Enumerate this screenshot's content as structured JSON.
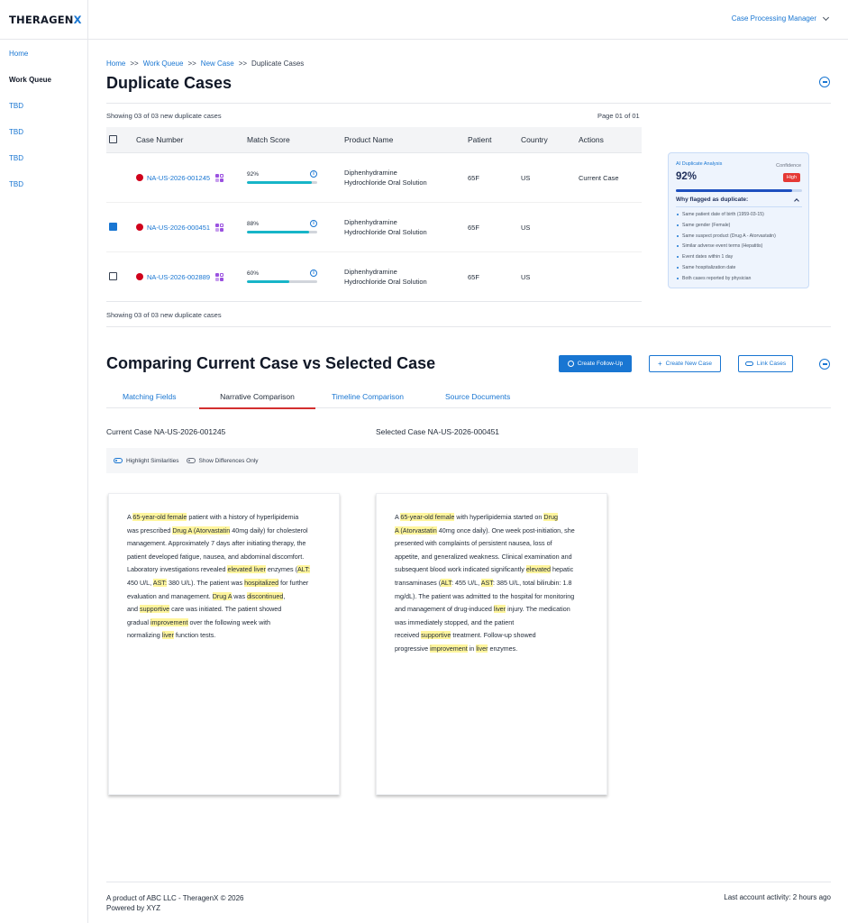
{
  "brand": {
    "name": "THERAGEN",
    "accent": "X"
  },
  "user_menu": {
    "label": "Case Processing Manager"
  },
  "sidebar": {
    "items": [
      {
        "label": "Home",
        "active": false
      },
      {
        "label": "Work Queue",
        "active": true
      },
      {
        "label": "TBD",
        "active": false
      },
      {
        "label": "TBD",
        "active": false
      },
      {
        "label": "TBD",
        "active": false
      },
      {
        "label": "TBD",
        "active": false
      }
    ]
  },
  "breadcrumb": {
    "items": [
      "Home",
      "Work Queue",
      "New Case"
    ],
    "separator": ">>",
    "current": "Duplicate Cases"
  },
  "page_title": "Duplicate Cases",
  "duplicates": {
    "showing_top": "Showing 03 of 03 new duplicate cases",
    "page_label": "Page 01 of 01",
    "showing_bottom": "Showing 03 of 03 new duplicate cases",
    "columns": [
      "Case Number",
      "Match Score",
      "Product Name",
      "Patient",
      "Country",
      "Actions"
    ],
    "rows": [
      {
        "checkbox": "none",
        "case_number": "NA-US-2026-001245",
        "score_label": "92%",
        "score": 0.92,
        "product_line1": "Diphenhydramine",
        "product_line2": "Hydrochloride Oral Solution",
        "patient": "65F",
        "country": "US",
        "action": "Current Case"
      },
      {
        "checkbox": "checked",
        "case_number": "NA-US-2026-000451",
        "score_label": "88%",
        "score": 0.88,
        "product_line1": "Diphenhydramine",
        "product_line2": "Hydrochloride Oral Solution",
        "patient": "65F",
        "country": "US",
        "action": ""
      },
      {
        "checkbox": "unchecked",
        "case_number": "NA-US-2026-002889",
        "score_label": "60%",
        "score": 0.6,
        "product_line1": "Diphenhydramine",
        "product_line2": "Hydrochloride Oral Solution",
        "patient": "65F",
        "country": "US",
        "action": ""
      }
    ]
  },
  "ai_analysis": {
    "title": "AI Duplicate Analysis",
    "confidence_label": "Confidence",
    "score_label": "92%",
    "score": 0.92,
    "badge": "High",
    "why_label": "Why flagged as duplicate:",
    "reasons": [
      "Same patient date of birth (1959-03-15)",
      "Same gender (Female)",
      "Same suspect product (Drug A - Atorvastatin)",
      "Similar adverse event terms (Hepatitis)",
      "Event dates within 1 day",
      "Same hospitalization date",
      "Both cases reported by physician"
    ]
  },
  "comparison": {
    "title": "Comparing Current Case vs Selected Case",
    "buttons": {
      "follow_up": "Create Follow-Up",
      "new_case": "Create New Case",
      "link": "Link Cases"
    },
    "tabs": [
      "Matching Fields",
      "Narrative Comparison",
      "Timeline Comparison",
      "Source Documents"
    ],
    "active_tab": 1,
    "current_case_label": "Current Case NA-US-2026-001245",
    "selected_case_label": "Selected Case NA-US-2026-000451",
    "toggles": {
      "highlight": "Highlight Similarities",
      "differences": "Show Differences Only"
    },
    "left_narrative": [
      [
        "A ",
        {
          "h": "65-year-old female"
        },
        " patient with a history of hyperlipidemia"
      ],
      [
        "was prescribed ",
        {
          "h": "Drug A (Atorvastatin"
        },
        " 40mg daily) for cholesterol"
      ],
      [
        "management. Approximately 7 days after initiating therapy, the"
      ],
      [
        "patient developed fatigue, nausea, and abdominal discomfort."
      ],
      [
        "Laboratory investigations revealed ",
        {
          "h": "elevated liver"
        },
        " enzymes (",
        {
          "h": "ALT:"
        }
      ],
      [
        "450 U/L, ",
        {
          "h": "AST:"
        },
        " 380 U/L). The patient was ",
        {
          "h": "hospitalized"
        },
        " for further"
      ],
      [
        "evaluation and management. ",
        {
          "h": "Drug A"
        },
        " was ",
        {
          "h": "discontinued"
        },
        ","
      ],
      [
        "and ",
        {
          "h": "supportive"
        },
        " care was initiated. The patient showed"
      ],
      [
        "gradual ",
        {
          "h": "improvement"
        },
        " over the following week with"
      ],
      [
        "normalizing ",
        {
          "h": "liver"
        },
        " function tests."
      ]
    ],
    "right_narrative": [
      [
        "A ",
        {
          "h": "65-year-old female"
        },
        " with hyperlipidemia started on ",
        {
          "h": "Drug"
        }
      ],
      [
        {
          "h": "A (Atorvastatin"
        },
        " 40mg once daily). One week post-initiation, she"
      ],
      [
        "presented with complaints of persistent nausea, loss of"
      ],
      [
        "appetite, and generalized weakness. Clinical examination and"
      ],
      [
        "subsequent blood work indicated significantly ",
        {
          "h": "elevated"
        },
        " hepatic"
      ],
      [
        "transaminases (",
        {
          "h": "ALT"
        },
        ": 455 U/L, ",
        {
          "h": "AST"
        },
        ": 385 U/L, total bilirubin: 1.8"
      ],
      [
        "mg/dL). The patient was admitted to the hospital for monitoring"
      ],
      [
        "and management of drug-induced ",
        {
          "h": "liver"
        },
        " injury. The medication"
      ],
      [
        "was immediately stopped, and the patient"
      ],
      [
        "received ",
        {
          "h": "supportive"
        },
        " treatment. Follow-up showed"
      ],
      [
        "progressive ",
        {
          "h": "improvement"
        },
        " in ",
        {
          "h": "liver"
        },
        " enzymes."
      ]
    ]
  },
  "footer": {
    "line1": "A product of ABC LLC - TheragenX © 2026",
    "line2": "Powered by XYZ",
    "activity": "Last account activity: 2 hours ago"
  }
}
